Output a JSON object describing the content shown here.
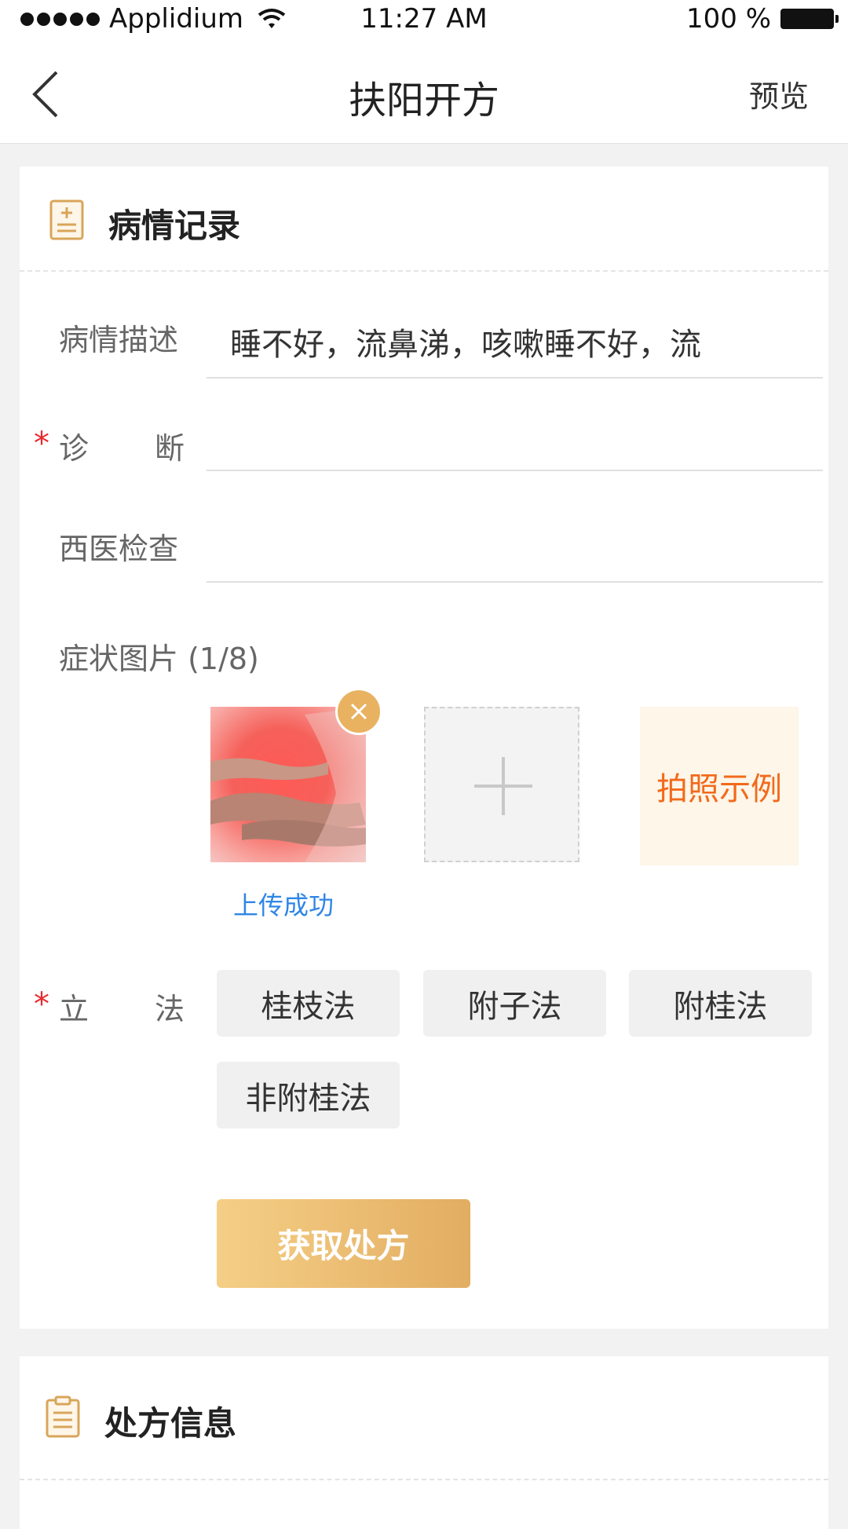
{
  "status_bar": {
    "carrier": "Applidium",
    "time": "11:27 AM",
    "battery": "100 %"
  },
  "nav": {
    "title": "扶阳开方",
    "right_action": "预览"
  },
  "section1": {
    "title": "病情记录",
    "fields": {
      "description_label": "病情描述",
      "description_value": "睡不好，流鼻涕，咳嗽睡不好，流",
      "diagnosis_label_a": "诊",
      "diagnosis_label_b": "断",
      "diagnosis_value": "",
      "western_exam_label": "西医检查",
      "western_exam_value": ""
    },
    "required_mark": "*",
    "photos": {
      "label": "症状图片 (1/8)",
      "upload_status": "上传成功",
      "example_label": "拍照示例"
    },
    "method": {
      "label_a": "立",
      "label_b": "法",
      "options": [
        "桂枝法",
        "附子法",
        "附桂法",
        "非附桂法"
      ]
    },
    "get_prescription_label": "获取处方"
  },
  "section2": {
    "title": "处方信息"
  },
  "colors": {
    "accent": "#e2ad62",
    "required": "#e8282c",
    "link": "#2f86e6",
    "example_text": "#f26a1b"
  }
}
